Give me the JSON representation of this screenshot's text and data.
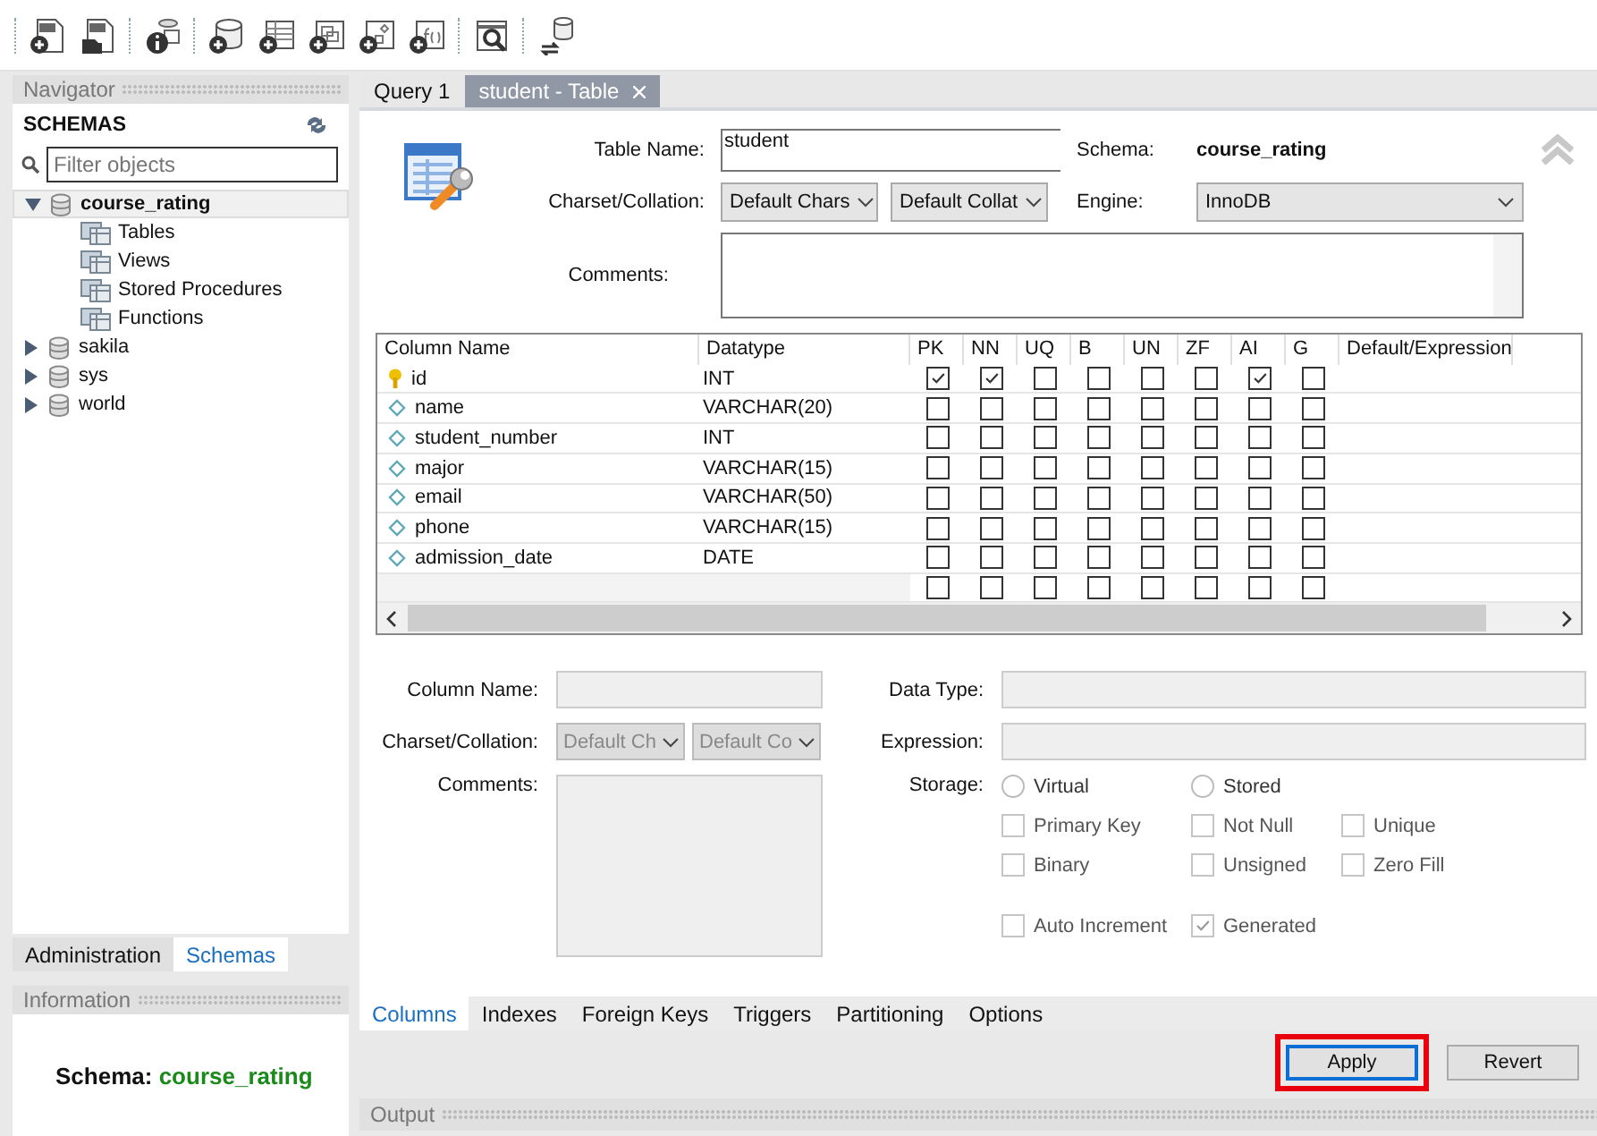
{
  "navigator": {
    "title": "Navigator",
    "schemas_label": "SCHEMAS",
    "filter": {
      "placeholder": "Filter objects"
    },
    "tree": [
      {
        "label": "course_rating",
        "expanded": true,
        "selected": true,
        "children": [
          {
            "label": "Tables"
          },
          {
            "label": "Views"
          },
          {
            "label": "Stored Procedures"
          },
          {
            "label": "Functions"
          }
        ]
      },
      {
        "label": "sakila",
        "expanded": false,
        "selected": false
      },
      {
        "label": "sys",
        "expanded": false,
        "selected": false
      },
      {
        "label": "world",
        "expanded": false,
        "selected": false
      }
    ]
  },
  "nav_tabs": [
    {
      "label": "Administration",
      "selected": false
    },
    {
      "label": "Schemas",
      "selected": true
    }
  ],
  "information": {
    "title": "Information",
    "schema_label": "Schema:",
    "schema_value": "course_rating"
  },
  "editor_tabs": [
    {
      "label": "Query 1",
      "selected": false,
      "closable": false
    },
    {
      "label": "student - Table",
      "selected": true,
      "closable": true
    }
  ],
  "table_form": {
    "table_name_label": "Table Name:",
    "table_name": "student",
    "schema_label": "Schema:",
    "schema": "course_rating",
    "charset_label": "Charset/Collation:",
    "charset": "Default Chars",
    "collation": "Default Collat",
    "engine_label": "Engine:",
    "engine": "InnoDB",
    "comments_label": "Comments:"
  },
  "grid": {
    "columns": [
      "Column Name",
      "Datatype",
      "PK",
      "NN",
      "UQ",
      "B",
      "UN",
      "ZF",
      "AI",
      "G",
      "Default/Expression"
    ],
    "rows": [
      {
        "name": "id",
        "type": "INT",
        "primary": true,
        "flags": [
          true,
          true,
          false,
          false,
          false,
          false,
          true,
          false
        ]
      },
      {
        "name": "name",
        "type": "VARCHAR(20)",
        "primary": false,
        "flags": [
          false,
          false,
          false,
          false,
          false,
          false,
          false,
          false
        ]
      },
      {
        "name": "student_number",
        "type": "INT",
        "primary": false,
        "flags": [
          false,
          false,
          false,
          false,
          false,
          false,
          false,
          false
        ]
      },
      {
        "name": "major",
        "type": "VARCHAR(15)",
        "primary": false,
        "flags": [
          false,
          false,
          false,
          false,
          false,
          false,
          false,
          false
        ]
      },
      {
        "name": "email",
        "type": "VARCHAR(50)",
        "primary": false,
        "flags": [
          false,
          false,
          false,
          false,
          false,
          false,
          false,
          false
        ]
      },
      {
        "name": "phone",
        "type": "VARCHAR(15)",
        "primary": false,
        "flags": [
          false,
          false,
          false,
          false,
          false,
          false,
          false,
          false
        ]
      },
      {
        "name": "admission_date",
        "type": "DATE",
        "primary": false,
        "flags": [
          false,
          false,
          false,
          false,
          false,
          false,
          false,
          false
        ]
      }
    ],
    "new_row": {
      "flags": [
        false,
        false,
        false,
        false,
        false,
        false,
        false,
        false
      ]
    }
  },
  "column_details": {
    "disabled": true,
    "column_name_label": "Column Name:",
    "charset_label": "Charset/Collation:",
    "charset": "Default Ch",
    "collation": "Default Co",
    "comments_label": "Comments:",
    "data_type_label": "Data Type:",
    "expression_label": "Expression:",
    "storage_label": "Storage:",
    "storage_options": [
      {
        "label": "Virtual",
        "selected": false
      },
      {
        "label": "Stored",
        "selected": false
      }
    ],
    "options": [
      {
        "label": "Primary Key",
        "checked": false
      },
      {
        "label": "Not Null",
        "checked": false
      },
      {
        "label": "Unique",
        "checked": false
      },
      {
        "label": "Binary",
        "checked": false
      },
      {
        "label": "Unsigned",
        "checked": false
      },
      {
        "label": "Zero Fill",
        "checked": false
      },
      {
        "label": "Auto Increment",
        "checked": false
      },
      {
        "label": "Generated",
        "checked": true
      }
    ]
  },
  "bottom_tabs": [
    {
      "label": "Columns",
      "selected": true
    },
    {
      "label": "Indexes",
      "selected": false
    },
    {
      "label": "Foreign Keys",
      "selected": false
    },
    {
      "label": "Triggers",
      "selected": false
    },
    {
      "label": "Partitioning",
      "selected": false
    },
    {
      "label": "Options",
      "selected": false
    }
  ],
  "buttons": [
    {
      "label": "Apply",
      "focused": true,
      "highlighted": true
    },
    {
      "label": "Revert",
      "focused": false,
      "highlighted": false
    }
  ],
  "output": {
    "title": "Output"
  }
}
